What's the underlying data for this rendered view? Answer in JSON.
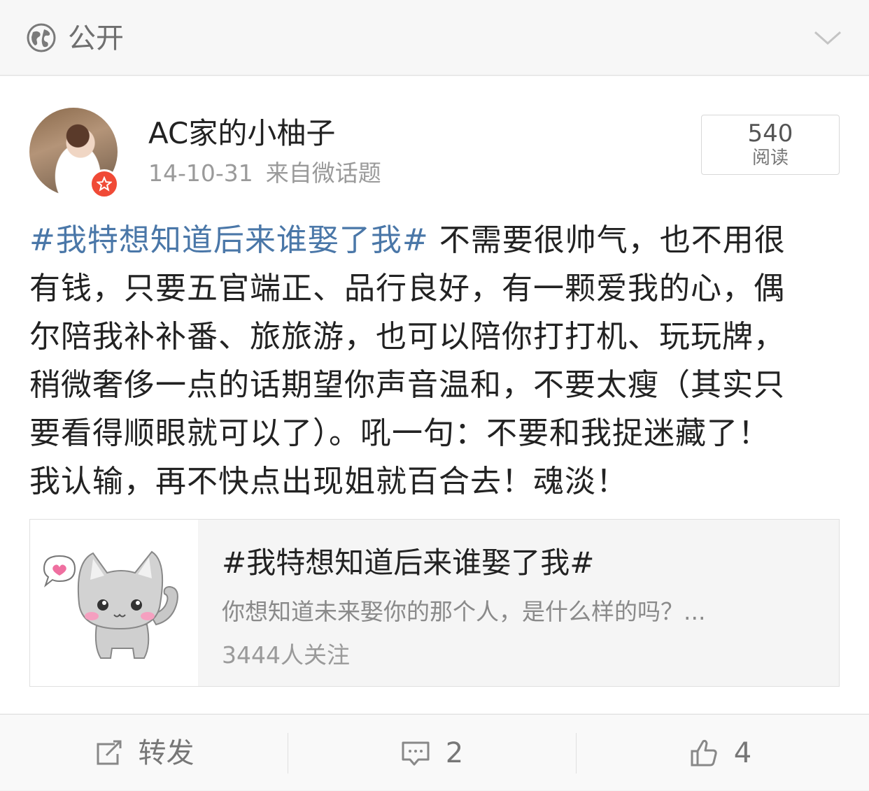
{
  "visibility": {
    "label": "公开",
    "icon": "globe-icon",
    "toggle_icon": "chevron-down-icon"
  },
  "post": {
    "author": "AC家的小柚子",
    "date": "14-10-31",
    "source": "来自微话题",
    "read_count": "540",
    "read_label": "阅读",
    "body": {
      "hashtag": "#我特想知道后来谁娶了我#",
      "line1_rest": " 不需要很帅气，也不用很",
      "line2": "有钱，只要五官端正、品行良好，有一颗爱我的心，偶",
      "line3": "尔陪我补补番、旅旅游，也可以陪你打打机、玩玩牌，",
      "line4": "稍微奢侈一点的话期望你声音温和，不要太瘦（其实只",
      "line5": "要看得顺眼就可以了）。吼一句：不要和我捉迷藏了！",
      "line6": "我认输，再不快点出现姐就百合去！魂淡！"
    }
  },
  "topic_card": {
    "title": "#我特想知道后来谁娶了我#",
    "description": "你想知道未来娶你的那个人，是什么样的吗？...",
    "followers": "3444人关注",
    "thumbnail_icon": "cat-illustration"
  },
  "actions": {
    "repost_label": "转发",
    "comment_count": "2",
    "like_count": "4"
  },
  "colors": {
    "hashtag": "#4a77a8",
    "badge": "#f04a36"
  }
}
